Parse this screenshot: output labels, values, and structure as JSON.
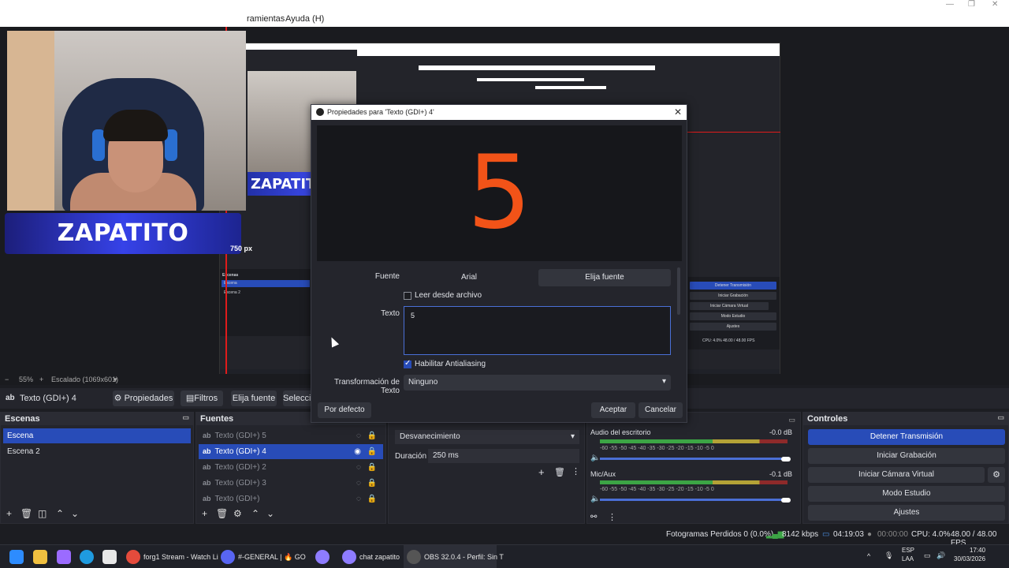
{
  "menu": {
    "tools": "ramientas",
    "help": "Ayuda (H)"
  },
  "banner_text": "ZAPATITO",
  "preview": {
    "canvas_label": "750 px",
    "zoom": "55%",
    "scale_label": "Escalado (1069x601)"
  },
  "nested": {
    "scenes_header": "Escenas",
    "scene1": "Escena",
    "scene2": "Escena 2",
    "ctrl_stop": "Detener Transmisión",
    "ctrl_record": "Iniciar Grabación",
    "ctrl_vcam": "Iniciar Cámara Virtual",
    "ctrl_studio": "Modo Estudio",
    "ctrl_settings": "Ajustes",
    "status": "CPU: 4.0%   48.00 / 48.00 FPS"
  },
  "context_bar": {
    "source_name": "Texto (GDI+) 4",
    "properties": "Propiedades",
    "filters": "Filtros",
    "choose_font": "Elija fuente",
    "select": "Seleccio"
  },
  "scenes": {
    "title": "Escenas",
    "items": [
      "Escena",
      "Escena 2"
    ]
  },
  "sources": {
    "title": "Fuentes",
    "items": [
      "Texto (GDI+) 5",
      "Texto (GDI+) 4",
      "Texto (GDI+) 2",
      "Texto (GDI+) 3",
      "Texto (GDI+)"
    ]
  },
  "transition": {
    "type": "Desvanecimiento",
    "duration_label": "Duración",
    "duration_value": "250 ms"
  },
  "mixer": {
    "desktop_label": "Audio del escritorio",
    "desktop_db": "-0.0 dB",
    "mic_label": "Mic/Aux",
    "mic_db": "-0.1 dB",
    "scale": "-60  -55  -50  -45  -40  -35  -30  -25  -20  -15  -10  -5   0"
  },
  "controls": {
    "title": "Controles",
    "stop_stream": "Detener Transmisión",
    "start_record": "Iniciar Grabación",
    "start_vcam": "Iniciar Cámara Virtual",
    "studio_mode": "Modo Estudio",
    "settings": "Ajustes"
  },
  "status": {
    "dropped": "Fotogramas Perdidos 0 (0.0%)",
    "bitrate": "8142 kbps",
    "stream_time": "04:19:03",
    "record_time": "00:00:00",
    "cpu": "CPU: 4.0%",
    "fps": "48.00 / 48.00 FPS"
  },
  "dialog": {
    "title": "Propiedades para 'Texto (GDI+) 4'",
    "preview_text": "5",
    "font_label": "Fuente",
    "font_value": "Arial",
    "choose_font": "Elija fuente",
    "read_file": "Leer desde archivo",
    "text_label": "Texto",
    "text_value": "5",
    "antialias": "Habilitar Antialiasing",
    "transform_label": "Transformación de Texto",
    "transform_value": "Ninguno",
    "defaults": "Por defecto",
    "accept": "Aceptar",
    "cancel": "Cancelar"
  },
  "taskbar": {
    "chrome": "forg1 Stream - Watch Li",
    "discord": "#-GENERAL | 🔥 GO",
    "chat": "chat zapatito",
    "obs": "OBS 32.0.4 - Perfil: Sin T",
    "lang1": "ESP",
    "lang2": "LAA",
    "time": "17:40",
    "date": "30/03/2026"
  },
  "colors": {
    "accent": "#284cb8",
    "preview_text": "#f25318",
    "dock_bg": "#24252c"
  }
}
